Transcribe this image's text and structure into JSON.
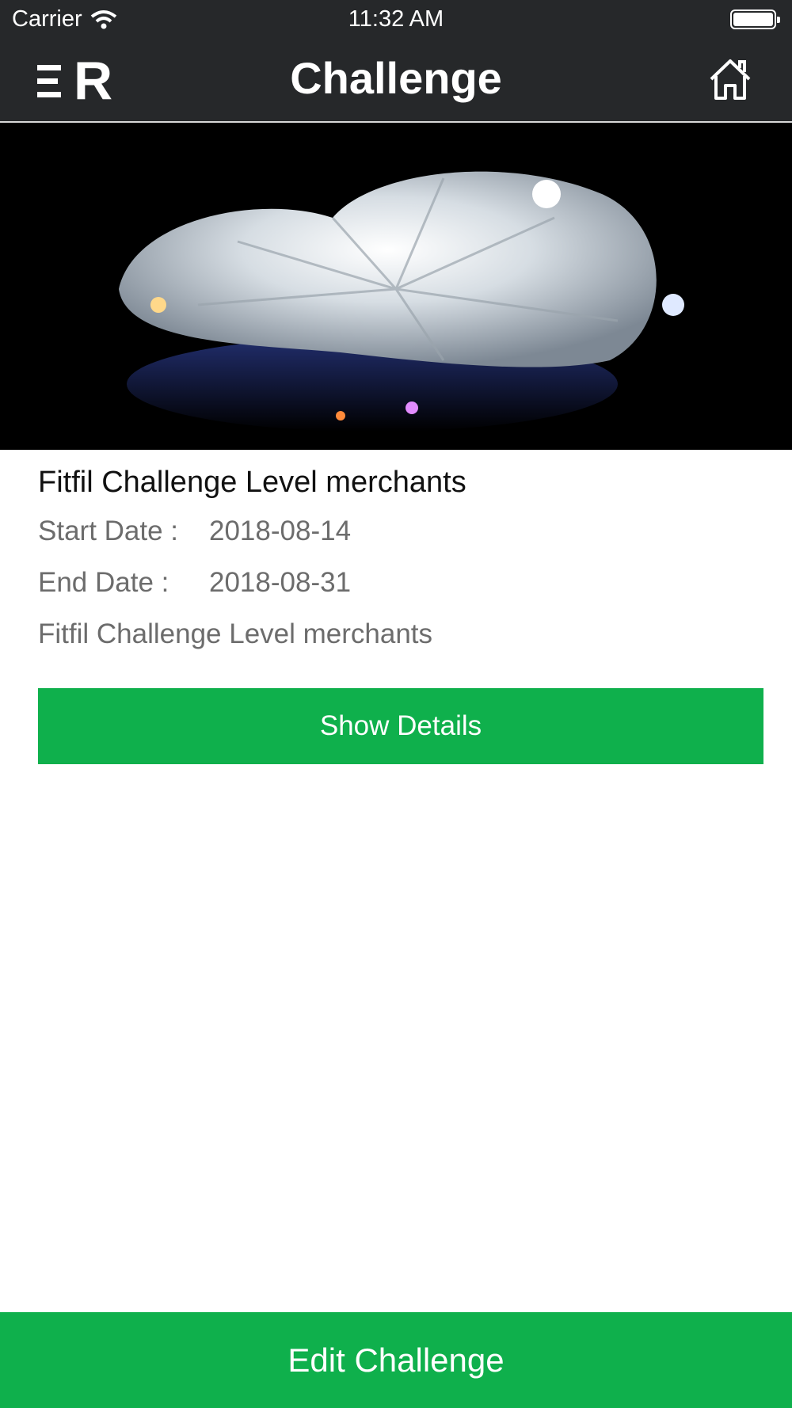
{
  "status_bar": {
    "carrier": "Carrier",
    "time": "11:32 AM"
  },
  "nav": {
    "logo_letter": "R",
    "title": "Challenge"
  },
  "challenge": {
    "title": "Fitfil Challenge  Level merchants",
    "start_label": "Start Date :",
    "start_value": "2018-08-14",
    "end_label": "End Date :",
    "end_value": "2018-08-31",
    "description": "Fitfil Challenge  Level merchants",
    "show_details_label": "Show Details"
  },
  "footer": {
    "edit_label": "Edit Challenge"
  },
  "colors": {
    "accent": "#0fb04c",
    "navbar": "#26282a"
  },
  "icons": [
    "wifi-icon",
    "battery-icon",
    "menu-icon",
    "home-icon"
  ]
}
